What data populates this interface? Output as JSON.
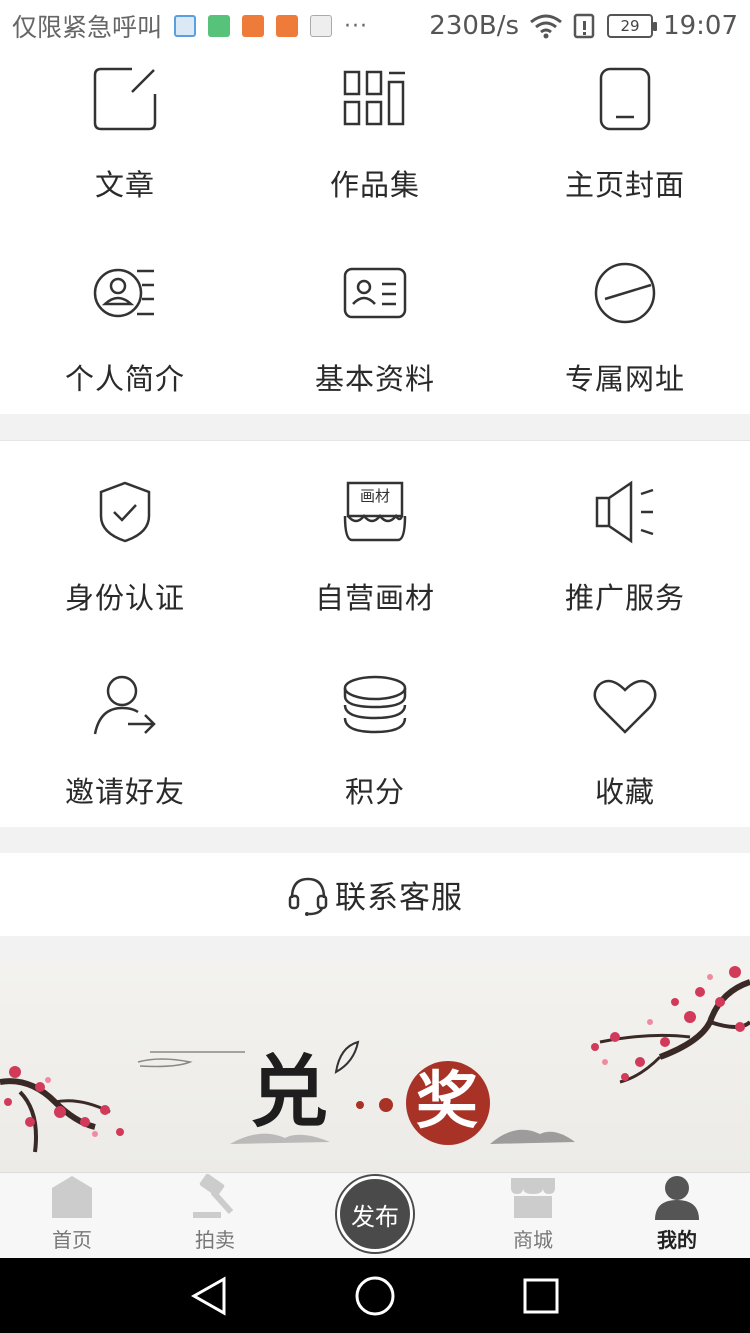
{
  "status_bar": {
    "carrier": "仅限紧急呼叫",
    "dots": "···",
    "speed": "230B/s",
    "battery": "29",
    "time": "19:07",
    "app_icons": [
      {
        "name": "browser-icon",
        "color": "#5aa0e0"
      },
      {
        "name": "bag-icon",
        "color": "#57c27a"
      },
      {
        "name": "taobao-icon-1",
        "color": "#ef7b3a"
      },
      {
        "name": "taobao-icon-2",
        "color": "#ef7b3a"
      },
      {
        "name": "font-icon",
        "color": "#aaaaaa"
      }
    ]
  },
  "section1": [
    {
      "label": "文章",
      "icon": "edit-icon"
    },
    {
      "label": "作品集",
      "icon": "collection-icon"
    },
    {
      "label": "主页封面",
      "icon": "tablet-icon"
    },
    {
      "label": "个人简介",
      "icon": "profile-icon"
    },
    {
      "label": "基本资料",
      "icon": "id-card-icon"
    },
    {
      "label": "专属网址",
      "icon": "link-icon"
    }
  ],
  "section2": [
    {
      "label": "身份认证",
      "icon": "shield-check-icon"
    },
    {
      "label": "自营画材",
      "icon": "art-supplies-icon",
      "icon_text": "画材"
    },
    {
      "label": "推广服务",
      "icon": "megaphone-icon"
    },
    {
      "label": "邀请好友",
      "icon": "invite-friend-icon"
    },
    {
      "label": "积分",
      "icon": "coins-icon"
    },
    {
      "label": "收藏",
      "icon": "heart-icon"
    }
  ],
  "contact": {
    "label": "联系客服",
    "icon": "headset-icon"
  },
  "banner": {
    "char_left": "兑",
    "char_right": "奖",
    "accent": "#a93226"
  },
  "tabbar": {
    "tabs": [
      {
        "label": "首页",
        "icon": "home-icon"
      },
      {
        "label": "拍卖",
        "icon": "gavel-icon"
      },
      {
        "label": "商城",
        "icon": "store-icon"
      },
      {
        "label": "我的",
        "icon": "user-icon",
        "active": true
      }
    ],
    "publish_label": "发布"
  },
  "colors": {
    "icon_stroke": "#333333",
    "tab_inactive": "#cccccc",
    "tab_active": "#555555",
    "divider": "#f2f2f2"
  }
}
